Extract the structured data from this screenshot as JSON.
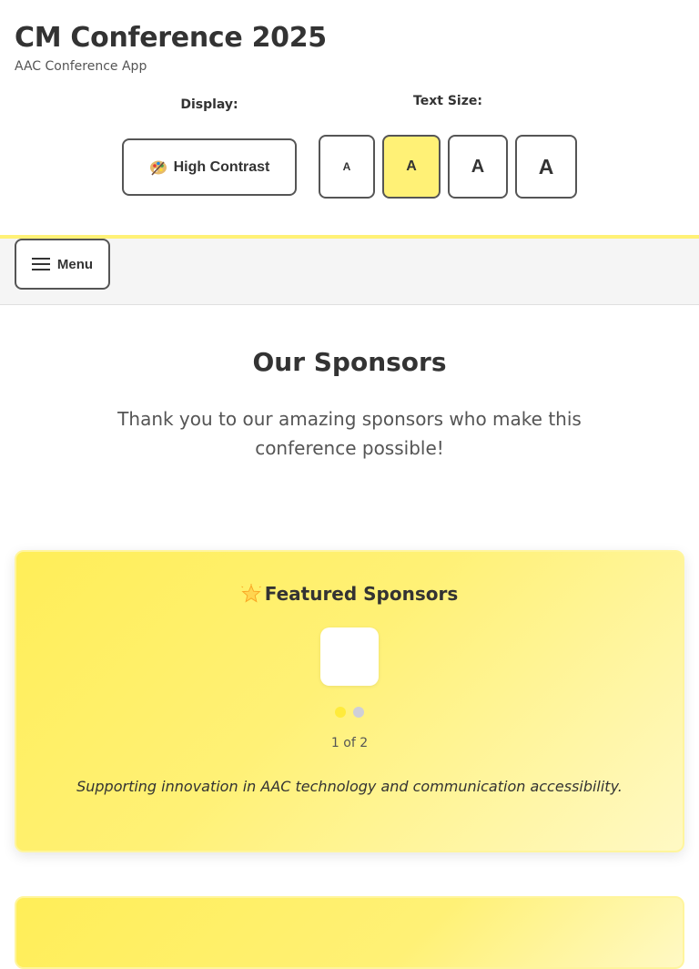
{
  "header": {
    "title": "CM Conference 2025",
    "subtitle": "AAC Conference App",
    "display_label": "Display:",
    "contrast_button_label": "High Contrast",
    "contrast_button_icon": "palette-icon",
    "text_size_label": "Text Size:",
    "text_size_buttons": [
      {
        "label": "A",
        "size": "small",
        "active": false
      },
      {
        "label": "A",
        "size": "medium",
        "active": true
      },
      {
        "label": "A",
        "size": "large",
        "active": false
      },
      {
        "label": "A",
        "size": "extra-large",
        "active": false
      }
    ]
  },
  "nav": {
    "menu_label": "Menu",
    "menu_icon": "hamburger-icon"
  },
  "main": {
    "title": "Our Sponsors",
    "intro": "Thank you to our amazing sponsors who make this conference possible!"
  },
  "featured": {
    "title": "Featured Sponsors",
    "icon": "star-icon",
    "slide_counter": "1 of 2",
    "current_slide": 1,
    "total_slides": 2,
    "tagline": "Supporting innovation in AAC technology and communication accessibility."
  },
  "colors": {
    "accent": "#fff176",
    "accent_strong": "#ffeb3b",
    "text": "#333333",
    "border": "#555555",
    "nav_bg": "#f5f5f5"
  }
}
